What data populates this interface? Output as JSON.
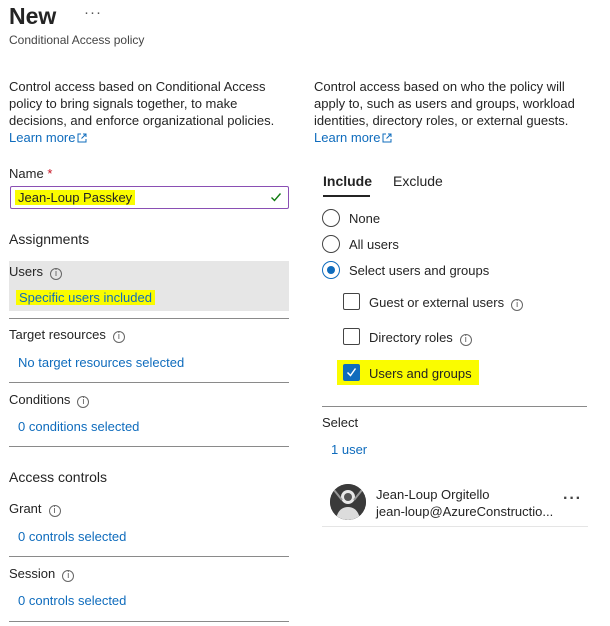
{
  "header": {
    "title": "New",
    "more_label": "···",
    "subtitle": "Conditional Access policy"
  },
  "left": {
    "description": "Control access based on Conditional Access policy to bring signals together, to make decisions, and enforce organizational policies.",
    "learn_more": "Learn more",
    "name_label": "Name",
    "required_mark": "*",
    "name_value": "Jean-Loup Passkey",
    "assignments_heading": "Assignments",
    "users_label": "Users",
    "users_value": "Specific users included",
    "target_label": "Target resources",
    "target_value": "No target resources selected",
    "conditions_label": "Conditions",
    "conditions_value": "0 conditions selected",
    "access_heading": "Access controls",
    "grant_label": "Grant",
    "grant_value": "0 controls selected",
    "session_label": "Session",
    "session_value": "0 controls selected"
  },
  "right": {
    "description": "Control access based on who the policy will apply to, such as users and groups, workload identities, directory roles, or external guests.",
    "learn_more": "Learn more",
    "tabs": [
      {
        "label": "Include",
        "selected": true
      },
      {
        "label": "Exclude",
        "selected": false
      }
    ],
    "radios": [
      {
        "label": "None",
        "checked": false
      },
      {
        "label": "All users",
        "checked": false
      },
      {
        "label": "Select users and groups",
        "checked": true
      }
    ],
    "checkboxes": [
      {
        "label": "Guest or external users",
        "checked": false
      },
      {
        "label": "Directory roles",
        "checked": false
      },
      {
        "label": "Users and groups",
        "checked": true
      }
    ],
    "select_label": "Select",
    "select_count": "1 user",
    "user": {
      "name": "Jean-Loup Orgitello",
      "email": "jean-loup@AzureConstructio...",
      "menu": "···"
    }
  },
  "colors": {
    "link": "#0f6cbd",
    "highlight": "#fafc00",
    "input_border": "#8a4fb4",
    "selected_panel": "#e6e6e6"
  }
}
